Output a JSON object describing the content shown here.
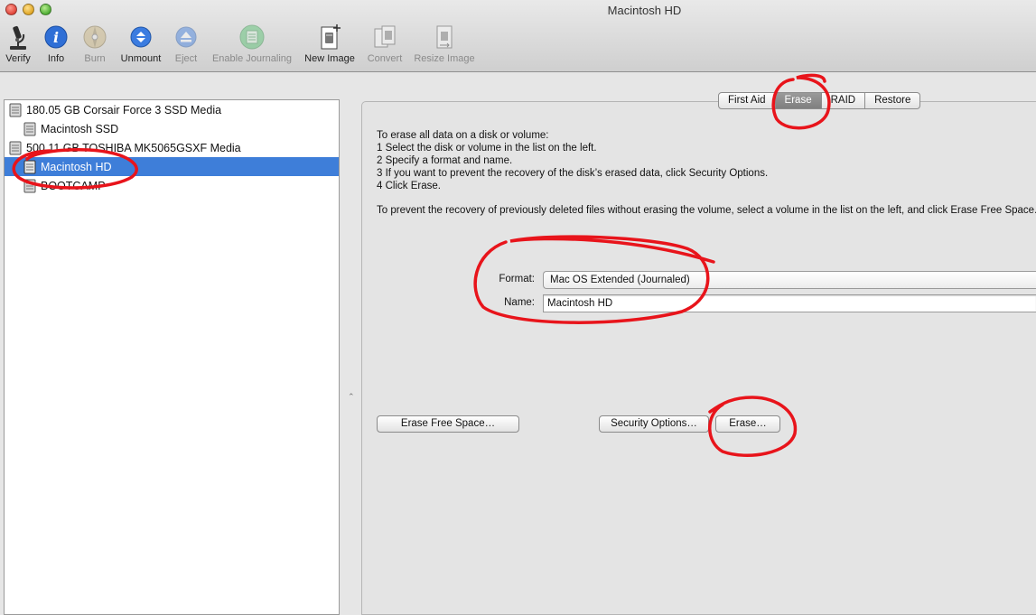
{
  "window": {
    "title": "Macintosh HD"
  },
  "toolbar": {
    "items": [
      {
        "label": "Verify",
        "icon": "microscope-icon",
        "enabled": true
      },
      {
        "label": "Info",
        "icon": "info-icon",
        "enabled": true
      },
      {
        "label": "Burn",
        "icon": "burn-disc-icon",
        "enabled": false
      },
      {
        "label": "Unmount",
        "icon": "unmount-icon",
        "enabled": true
      },
      {
        "label": "Eject",
        "icon": "eject-icon",
        "enabled": false
      },
      {
        "label": "Enable Journaling",
        "icon": "journaling-icon",
        "enabled": false
      },
      {
        "label": "New Image",
        "icon": "new-image-icon",
        "enabled": true
      },
      {
        "label": "Convert",
        "icon": "convert-icon",
        "enabled": false
      },
      {
        "label": "Resize Image",
        "icon": "resize-image-icon",
        "enabled": false
      }
    ]
  },
  "sidebar": {
    "disks": [
      {
        "label": "180.05 GB Corsair Force 3 SSD Media",
        "level": 0,
        "selected": false
      },
      {
        "label": "Macintosh SSD",
        "level": 1,
        "selected": false
      },
      {
        "label": "500.11 GB TOSHIBA MK5065GSXF Media",
        "level": 0,
        "selected": false
      },
      {
        "label": "Macintosh HD",
        "level": 1,
        "selected": true
      },
      {
        "label": "BOOTCAMP",
        "level": 1,
        "selected": false
      }
    ]
  },
  "tabs": [
    {
      "label": "First Aid",
      "active": false
    },
    {
      "label": "Erase",
      "active": true
    },
    {
      "label": "RAID",
      "active": false
    },
    {
      "label": "Restore",
      "active": false
    }
  ],
  "erase": {
    "instructions": [
      "To erase all data on a disk or volume:",
      "1 Select the disk or volume in the list on the left.",
      "2 Specify a format and name.",
      "3 If you want to prevent the recovery of the disk’s erased data, click Security Options.",
      "4 Click Erase."
    ],
    "prevent_text": "To prevent the recovery of previously deleted files without erasing the volume, select a volume in the list on the left, and click Erase Free Space.",
    "format_label": "Format:",
    "format_value": "Mac OS Extended (Journaled)",
    "name_label": "Name:",
    "name_value": "Macintosh HD",
    "erase_free_space_label": "Erase Free Space…",
    "security_options_label": "Security Options…",
    "erase_label": "Erase…"
  },
  "colors": {
    "selection": "#3e7ed9",
    "annotation": "#e8141b"
  }
}
